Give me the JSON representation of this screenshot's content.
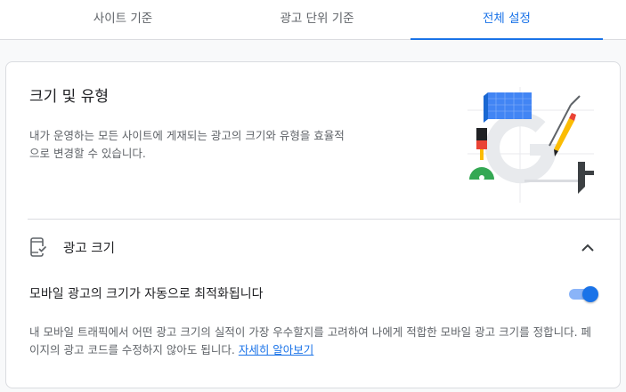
{
  "tabs": [
    {
      "label": "사이트 기준",
      "active": false
    },
    {
      "label": "광고 단위 기준",
      "active": false
    },
    {
      "label": "전체 설정",
      "active": true
    }
  ],
  "card": {
    "title": "크기 및 유형",
    "description": "내가 운영하는 모든 사이트에 게재되는 광고의 크기와 유형을 효율적으로 변경할 수 있습니다.",
    "illustration_icon": "design-tools-illustration"
  },
  "section": {
    "icon": "mobile-check-icon",
    "title": "광고 크기",
    "expanded": true,
    "toggle_label": "모바일 광고의 크기가 자동으로 최적화됩니다",
    "toggle_on": true,
    "help_text": "내 모바일 트래픽에서 어떤 광고 크기의 실적이 가장 우수할지를 고려하여 나에게 적합한 모바일 광고 크기를 정합니다. 페이지의 광고 코드를 수정하지 않아도 됩니다.",
    "learn_more": "자세히 알아보기"
  },
  "colors": {
    "accent": "#1a73e8",
    "toggle_track": "#8ab4f8",
    "divider": "#dadce0"
  }
}
